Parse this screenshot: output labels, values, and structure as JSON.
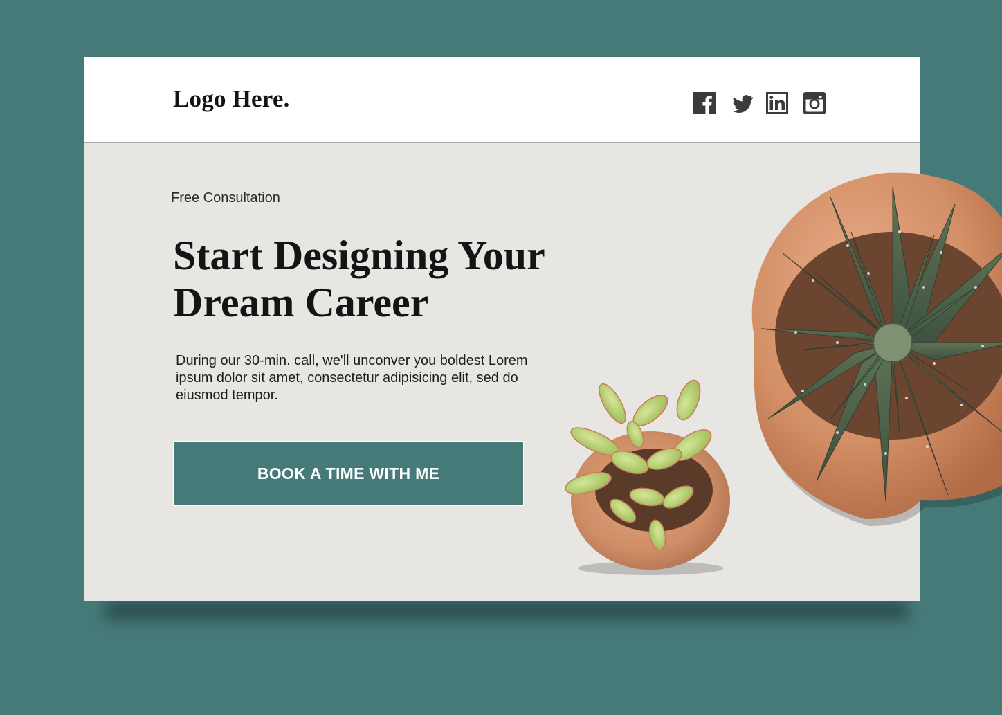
{
  "header": {
    "logo": "Logo Here.",
    "socials": [
      {
        "icon": "facebook-icon"
      },
      {
        "icon": "twitter-icon"
      },
      {
        "icon": "linkedin-icon"
      },
      {
        "icon": "instagram-icon"
      }
    ]
  },
  "hero": {
    "eyebrow": "Free Consultation",
    "headline_line1": "Start Designing Your",
    "headline_line2": "Dream Career",
    "description": "During our 30-min. call, we'll unconver you boldest Lorem ipsum dolor sit amet, consectetur adipisicing elit, sed do eiusmod tempor.",
    "cta_label": "BOOK A TIME WITH ME"
  },
  "colors": {
    "background": "#467a79",
    "card": "#e8e6e3",
    "header": "#ffffff",
    "accent": "#467a79",
    "text": "#141414",
    "icon": "#3b3b3b"
  }
}
